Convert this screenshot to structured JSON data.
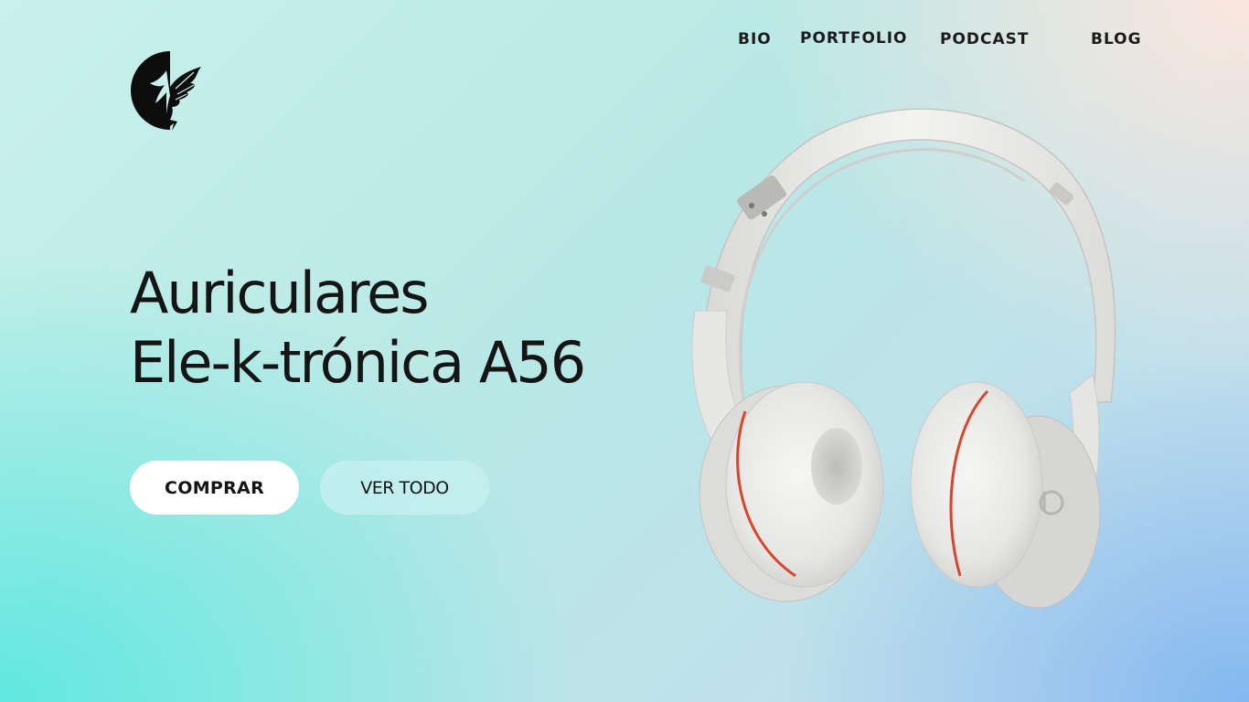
{
  "brand": {
    "logo_icon": "phoenix-half-moon-logo-icon"
  },
  "nav": {
    "items": [
      {
        "label": "BIO"
      },
      {
        "label": "PORTFOLIO"
      },
      {
        "label": "PODCAST"
      },
      {
        "label": "BLOG"
      }
    ]
  },
  "hero": {
    "title_line1": "Auriculares",
    "title_line2": "Ele-k-trónica A56",
    "buy_label": "COMPRAR",
    "view_all_label": "VER TODO",
    "product_image": "white-headphones-image"
  },
  "colors": {
    "text": "#151515",
    "button_primary_bg": "#ffffff",
    "button_secondary_bg": "#c8f0f0",
    "bg_teal": "#60e8e0",
    "bg_peach": "#ffe6de",
    "bg_blue": "#80b6f0"
  }
}
